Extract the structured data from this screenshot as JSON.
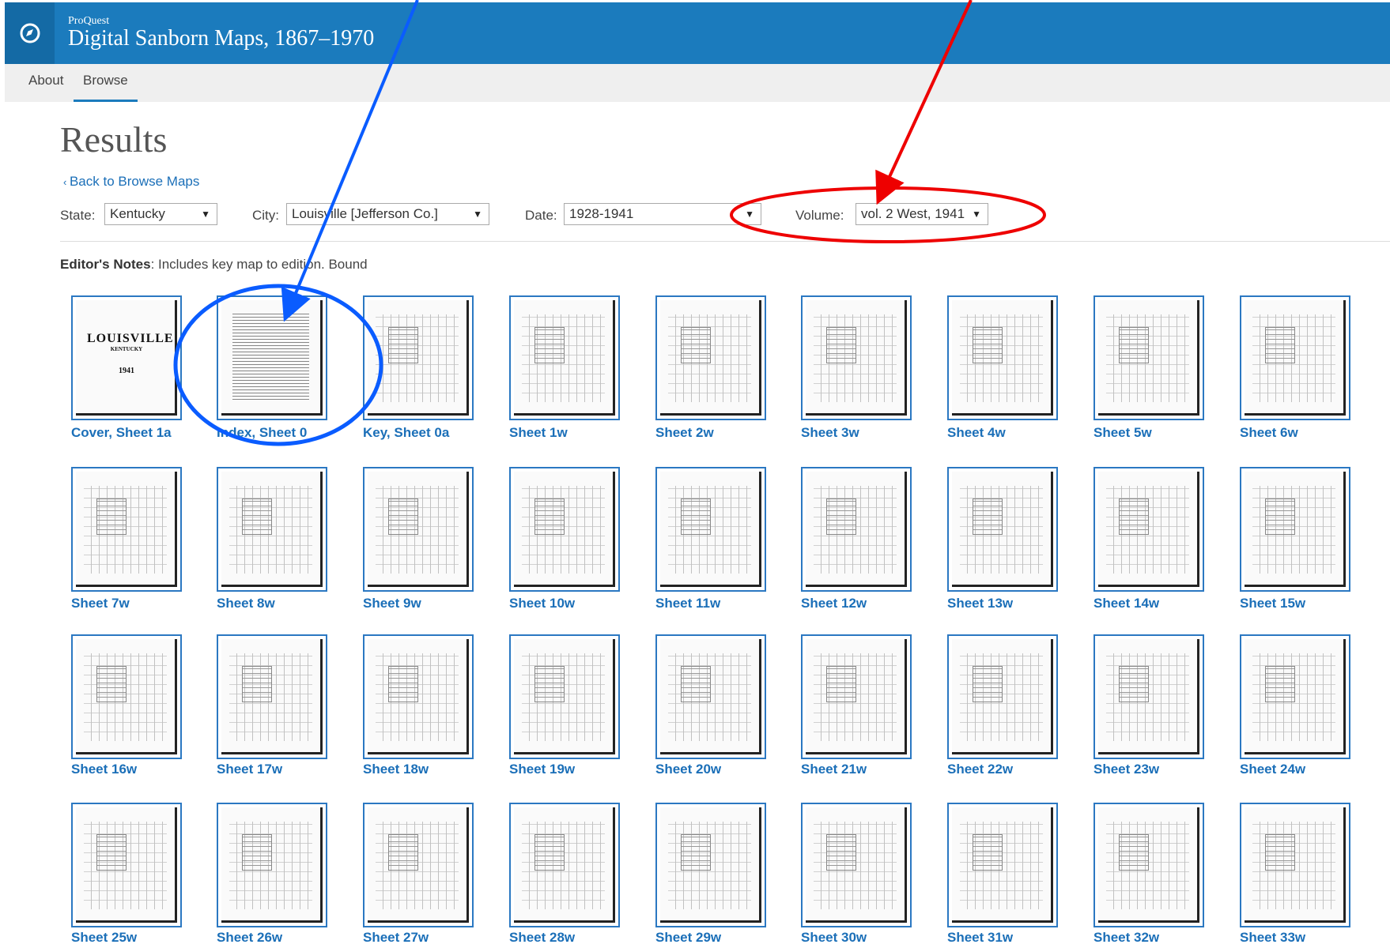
{
  "header": {
    "brand_small": "ProQuest",
    "brand_title": "Digital Sanborn Maps, 1867–1970",
    "logo_icon": "compass-icon",
    "bg_color": "#1b7bbd"
  },
  "nav": {
    "about": "About",
    "browse": "Browse",
    "active": "Browse"
  },
  "page_title": "Results",
  "back_link": "Back to Browse Maps",
  "filters": {
    "state_label": "State:",
    "state_value": "Kentucky",
    "city_label": "City:",
    "city_value": "Louisville [Jefferson Co.]",
    "date_label": "Date:",
    "date_value": "1928-1941",
    "volume_label": "Volume:",
    "volume_value": "vol. 2 West, 1941"
  },
  "notes": {
    "label": "Editor's Notes",
    "text": ": Includes key map to edition. Bound"
  },
  "cover_text": {
    "title": "LOUISVILLE",
    "state": "KENTUCKY",
    "volume": "1941"
  },
  "sheets": [
    "Cover, Sheet 1a",
    "Index, Sheet 0",
    "Key, Sheet 0a",
    "Sheet 1w",
    "Sheet 2w",
    "Sheet 3w",
    "Sheet 4w",
    "Sheet 5w",
    "Sheet 6w",
    "Sheet 7w",
    "Sheet 8w",
    "Sheet 9w",
    "Sheet 10w",
    "Sheet 11w",
    "Sheet 12w",
    "Sheet 13w",
    "Sheet 14w",
    "Sheet 15w",
    "Sheet 16w",
    "Sheet 17w",
    "Sheet 18w",
    "Sheet 19w",
    "Sheet 20w",
    "Sheet 21w",
    "Sheet 22w",
    "Sheet 23w",
    "Sheet 24w",
    "Sheet 25w",
    "Sheet 26w",
    "Sheet 27w",
    "Sheet 28w",
    "Sheet 29w",
    "Sheet 30w",
    "Sheet 31w",
    "Sheet 32w",
    "Sheet 33w"
  ],
  "annotation_colors": {
    "blue": "#0a5cff",
    "red": "#ee0000"
  }
}
